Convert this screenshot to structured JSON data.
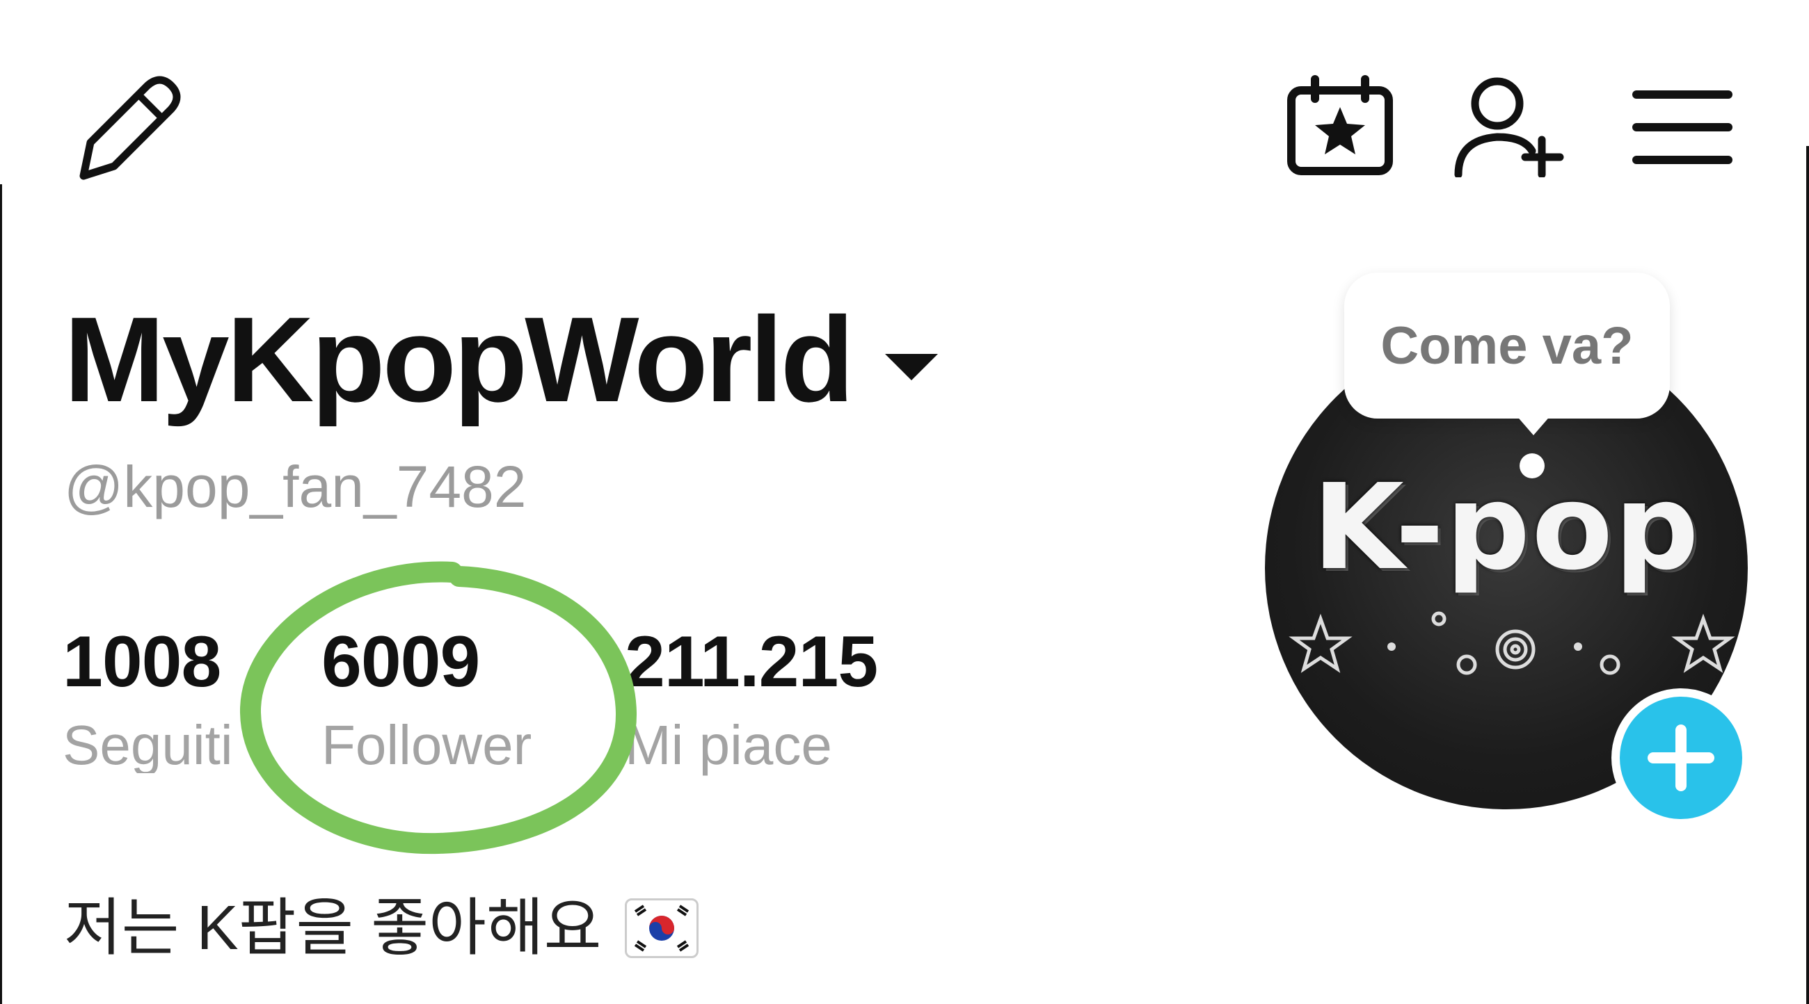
{
  "header": {
    "icons": [
      "pencil-icon",
      "calendar-star-icon",
      "add-friend-icon",
      "menu-icon"
    ]
  },
  "profile": {
    "display_name": "MyKpopWorld",
    "handle": "@kpop_fan_7482",
    "stats": {
      "following_value": "1008",
      "following_label": "Seguiti",
      "followers_value": "6009",
      "followers_label": "Follower",
      "likes_value": "211.215",
      "likes_label": "Mi piace"
    },
    "bio": "저는 K팝을 좋아해요",
    "bio_emoji": "flag-south-korea",
    "avatar_text": "K-pop",
    "status_bubble": "Come va?"
  },
  "colors": {
    "text": "#111111",
    "muted": "#9b9b9b",
    "add_button": "#29c2ea",
    "annotation": "#7bc45a"
  }
}
